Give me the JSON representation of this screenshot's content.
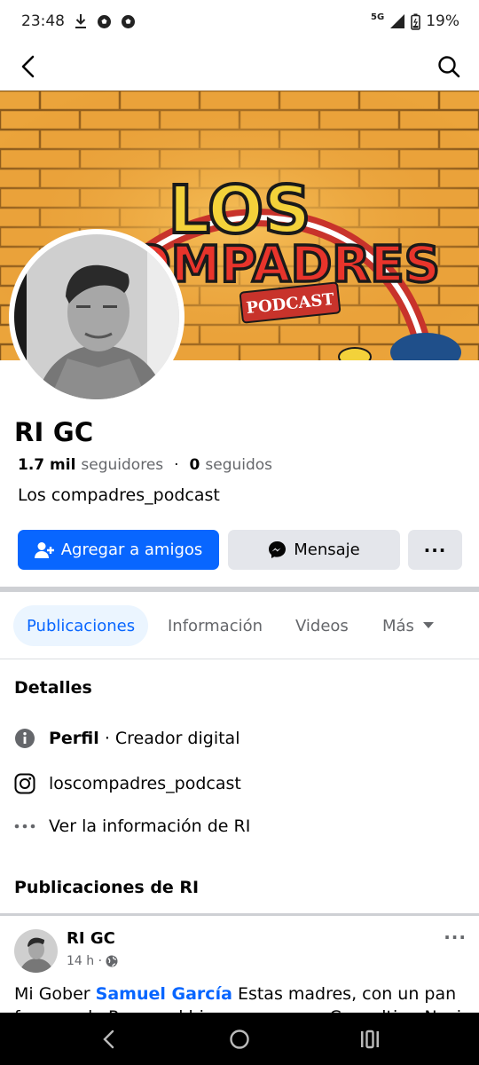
{
  "status_bar": {
    "time": "23:48",
    "network": "5G",
    "battery": "19%",
    "icons": [
      "download-icon",
      "soccer-ball-icon",
      "soccer-ball-icon",
      "signal-icon",
      "battery-icon"
    ]
  },
  "nav": {
    "back_icon": "back-arrow-icon",
    "search_icon": "search-icon"
  },
  "cover": {
    "title_line1": "LOS",
    "title_line2": "COMPADRES",
    "sign": "PODCAST"
  },
  "profile": {
    "name": "RI GC",
    "followers_count": "1.7 mil",
    "followers_label": "seguidores",
    "separator": "·",
    "following_count": "0",
    "following_label": "seguidos",
    "bio": "Los compadres_podcast"
  },
  "actions": {
    "add_friend_label": "Agregar a amigos",
    "message_label": "Mensaje",
    "more_label": "···"
  },
  "tabs": [
    {
      "label": "Publicaciones",
      "active": true
    },
    {
      "label": "Información",
      "active": false
    },
    {
      "label": "Videos",
      "active": false
    },
    {
      "label": "Más",
      "active": false
    }
  ],
  "details": {
    "title": "Detalles",
    "profile_label": "Perfil",
    "profile_value": " · Creador digital",
    "instagram": "loscompadres_podcast",
    "see_info": "Ver la información de RI"
  },
  "posts_section": {
    "title": "Publicaciones de RI"
  },
  "post": {
    "author": "RI GC",
    "time": "14 h ·",
    "menu_label": "···",
    "text_before": "Mi Gober ",
    "mention": "Samuel García",
    "text_after": " Estas madres, con un pan",
    "text_line2": "frances de Pan y sal bien marca mas Consulting Nacional"
  },
  "colors": {
    "accent": "#0866ff",
    "button_gray": "#e4e6eb",
    "secondary_text": "#65676b",
    "active_tab_bg": "#ebf5ff"
  }
}
